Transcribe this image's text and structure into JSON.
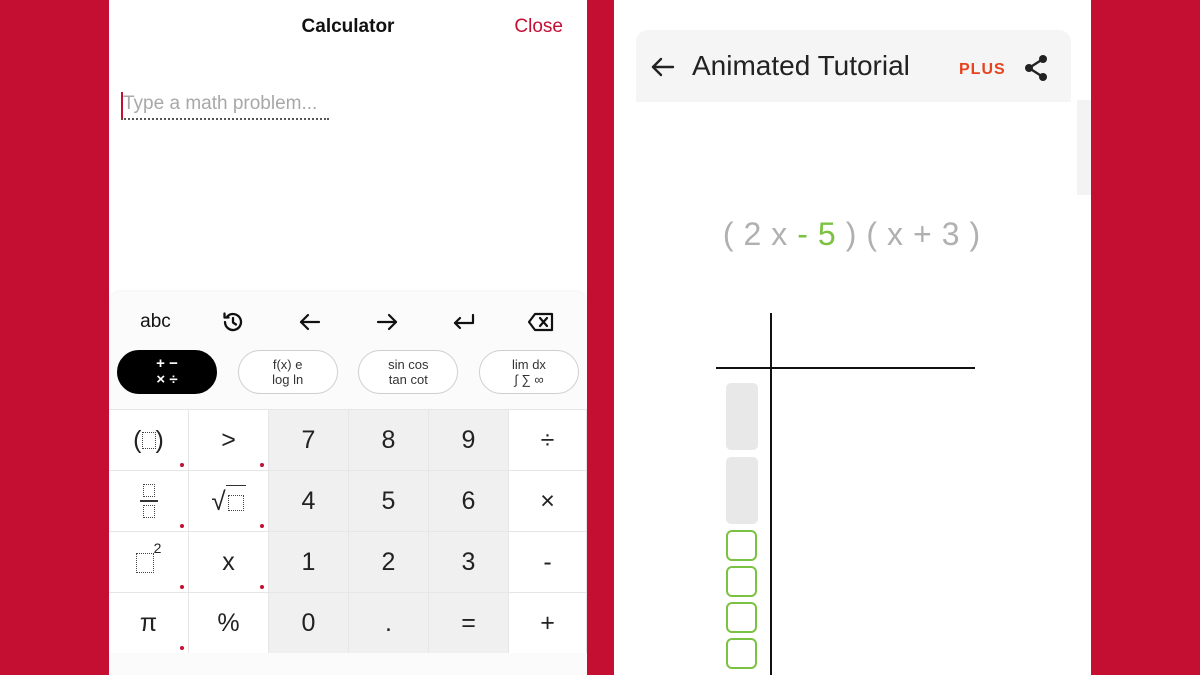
{
  "calculator": {
    "title": "Calculator",
    "close_label": "Close",
    "input_placeholder": "Type a math problem...",
    "toolbar": {
      "abc_label": "abc",
      "history_icon": "history-icon",
      "left_arrow": "←",
      "right_arrow": "→",
      "enter_icon": "enter-icon",
      "backspace_icon": "backspace-icon"
    },
    "modes": [
      {
        "line1": "+ −",
        "line2": "× ÷"
      },
      {
        "line1": "f(x)  e",
        "line2": "log  ln"
      },
      {
        "line1": "sin cos",
        "line2": "tan cot"
      },
      {
        "line1": "lim  dx",
        "line2": "∫ ∑ ∞"
      }
    ],
    "keys": {
      "gt": ">",
      "k7": "7",
      "k8": "8",
      "k9": "9",
      "div": "÷",
      "k4": "4",
      "k5": "5",
      "k6": "6",
      "mul": "×",
      "x": "x",
      "k1": "1",
      "k2": "2",
      "k3": "3",
      "minus": "-",
      "pi": "π",
      "percent": "%",
      "k0": "0",
      "dot": ".",
      "eq": "=",
      "plus": "+",
      "square_exp": "2"
    }
  },
  "tutorial": {
    "title": "Animated Tutorial",
    "plus_label": "PLUS",
    "expression": [
      "(",
      "2",
      "x",
      "-",
      "5",
      ")",
      "(",
      "x",
      "+",
      "3",
      ")"
    ],
    "accent_color": "#7bc242"
  },
  "colors": {
    "brand_red": "#c40f33",
    "green": "#7bc242",
    "plus_orange": "#e8431d"
  }
}
